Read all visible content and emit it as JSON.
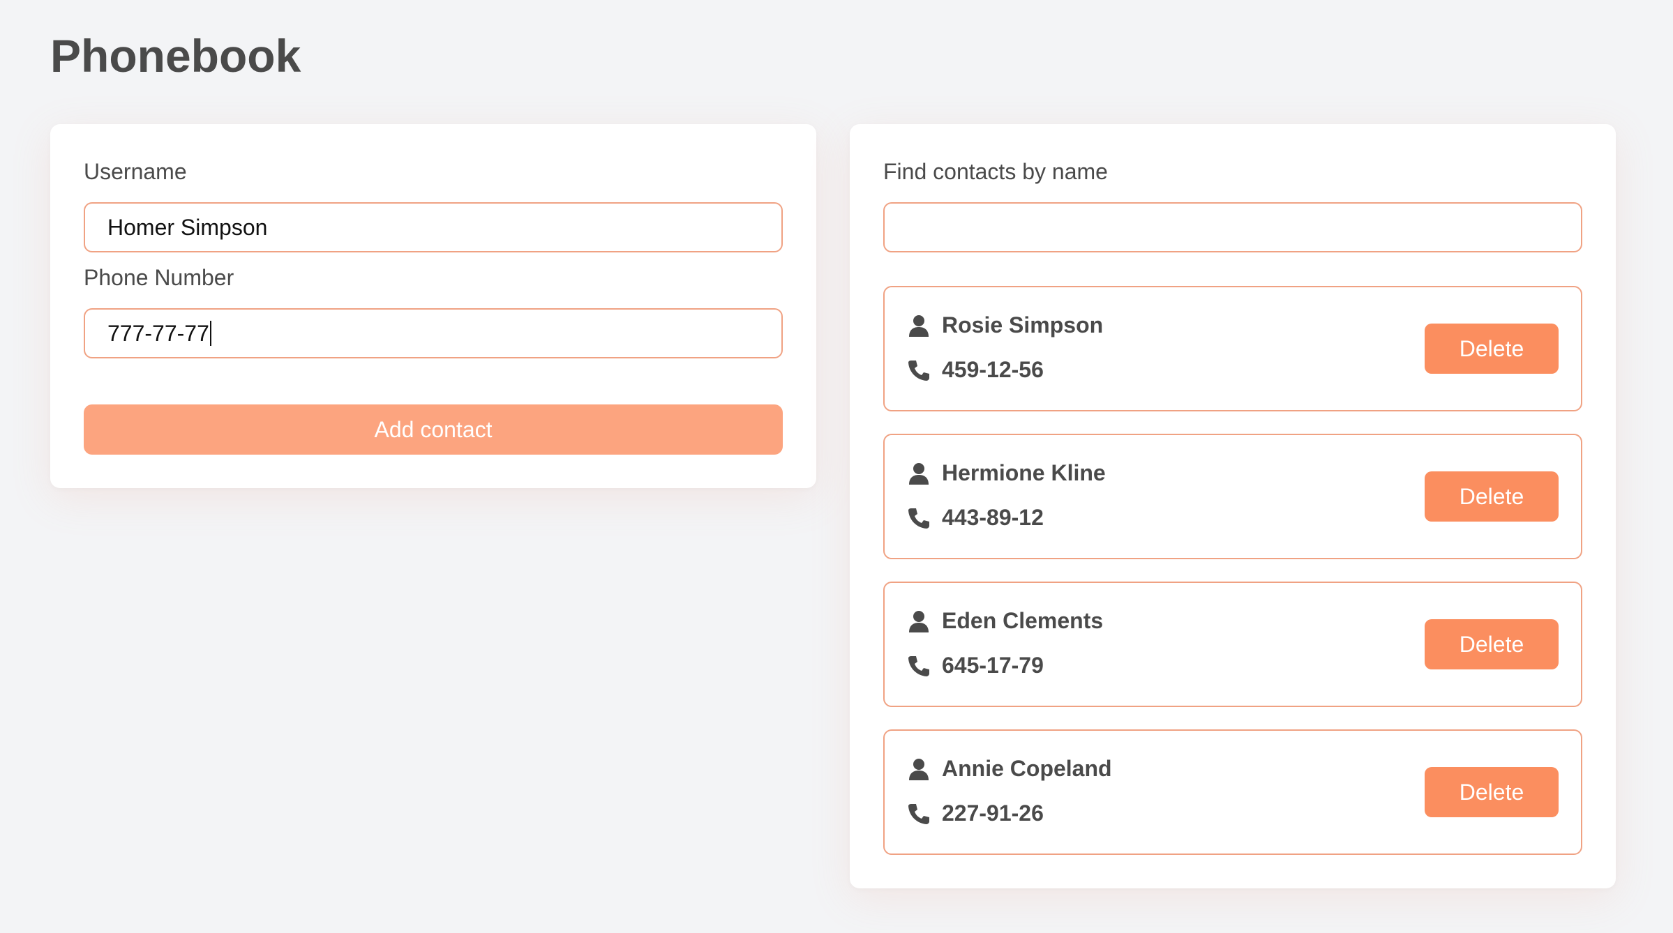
{
  "app": {
    "title": "Phonebook"
  },
  "form": {
    "username_label": "Username",
    "username_value": "Homer Simpson",
    "phone_label": "Phone Number",
    "phone_value": "777-77-77",
    "submit_label": "Add contact"
  },
  "filter": {
    "label": "Find contacts by name",
    "value": ""
  },
  "contacts": [
    {
      "name": "Rosie Simpson",
      "phone": "459-12-56",
      "delete_label": "Delete"
    },
    {
      "name": "Hermione Kline",
      "phone": "443-89-12",
      "delete_label": "Delete"
    },
    {
      "name": "Eden Clements",
      "phone": "645-17-79",
      "delete_label": "Delete"
    },
    {
      "name": "Annie Copeland",
      "phone": "227-91-26",
      "delete_label": "Delete"
    }
  ],
  "icons": {
    "person": "person-icon",
    "phone": "phone-icon"
  },
  "colors": {
    "accent": "#fb8e5f",
    "accent_light": "#fca47f",
    "border": "#f0a283",
    "text": "#4a4a4a",
    "background": "#f3f4f6"
  }
}
